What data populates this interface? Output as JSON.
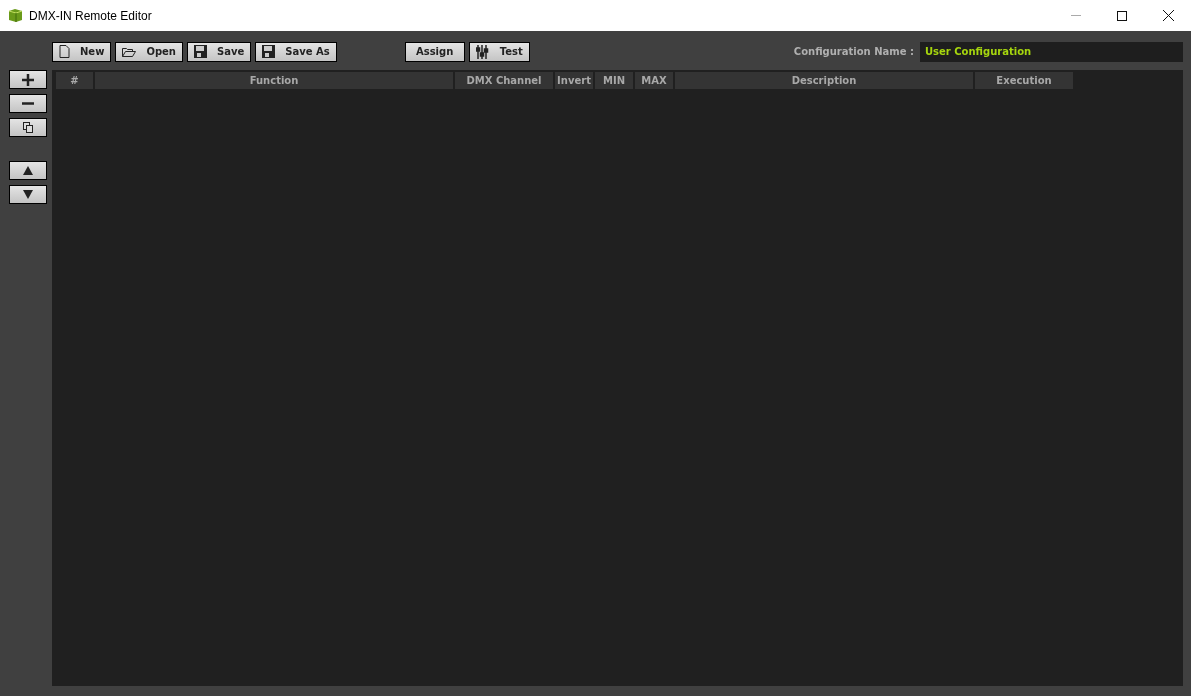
{
  "window": {
    "title": "DMX-IN Remote Editor"
  },
  "file_buttons": [
    {
      "label": "New",
      "kind": "new"
    },
    {
      "label": "Open",
      "kind": "open"
    },
    {
      "label": "Save",
      "kind": "save"
    },
    {
      "label": "Save As",
      "kind": "save"
    }
  ],
  "action_buttons": [
    {
      "label": "Assign",
      "kind": "plain"
    },
    {
      "label": "Test",
      "kind": "test"
    }
  ],
  "configuration": {
    "label": "Configuration Name :",
    "value": "User Configuration"
  },
  "table": {
    "columns": [
      "#",
      "Function",
      "DMX Channel",
      "Invert",
      "MIN",
      "MAX",
      "Description",
      "Execution"
    ]
  }
}
